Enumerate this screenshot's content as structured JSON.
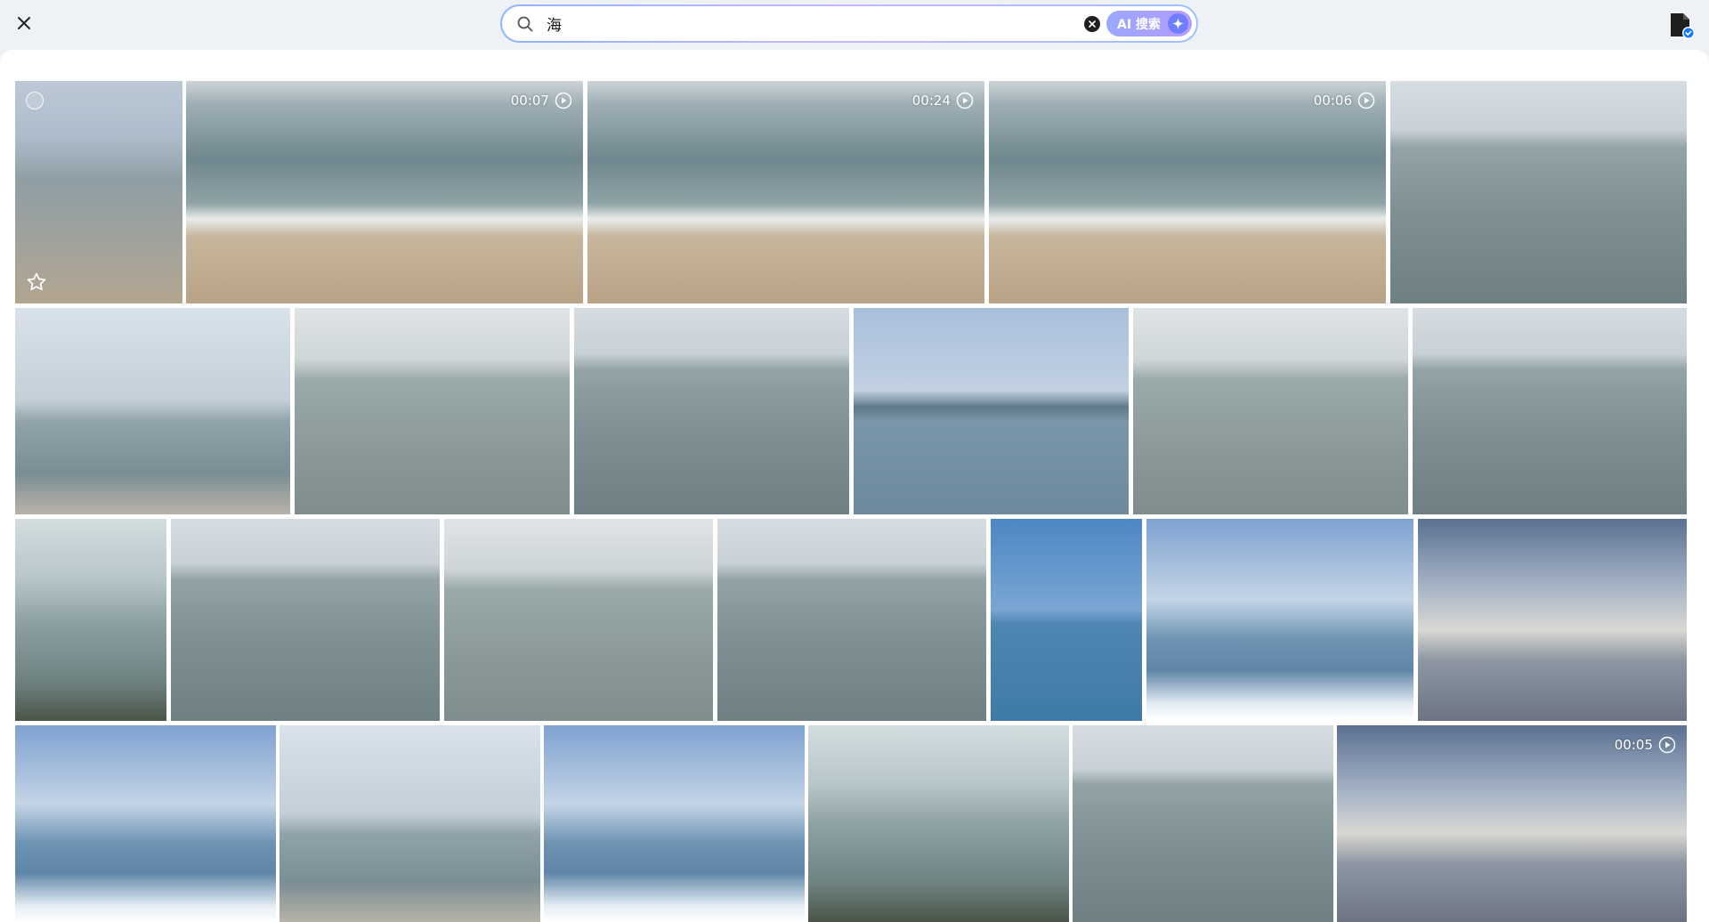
{
  "search": {
    "query": "海",
    "ai_label": "AI 搜索"
  },
  "photos": [
    {
      "type": "photo",
      "scene": "shore"
    },
    {
      "type": "video",
      "duration": "00:07",
      "scene": "beach"
    },
    {
      "type": "video",
      "duration": "00:24",
      "scene": "beach"
    },
    {
      "type": "video",
      "duration": "00:06",
      "scene": "beach"
    },
    {
      "type": "photo",
      "scene": "gray-sea"
    },
    {
      "type": "photo",
      "scene": "railing"
    },
    {
      "type": "photo",
      "scene": "rocks"
    },
    {
      "type": "photo",
      "scene": "gray-sea"
    },
    {
      "type": "photo",
      "scene": "island"
    },
    {
      "type": "photo",
      "scene": "rocks"
    },
    {
      "type": "photo",
      "scene": "gray-sea"
    },
    {
      "type": "photo",
      "scene": "coast"
    },
    {
      "type": "photo",
      "scene": "gray-sea"
    },
    {
      "type": "photo",
      "scene": "rocks"
    },
    {
      "type": "photo",
      "scene": "gray-sea"
    },
    {
      "type": "photo",
      "scene": "blue-sea"
    },
    {
      "type": "photo",
      "scene": "boat-wake"
    },
    {
      "type": "photo",
      "scene": "cloudy"
    },
    {
      "type": "photo",
      "scene": "boat-wake"
    },
    {
      "type": "photo",
      "scene": "railing"
    },
    {
      "type": "photo",
      "scene": "boat-wake"
    },
    {
      "type": "photo",
      "scene": "coast"
    },
    {
      "type": "photo",
      "scene": "gray-sea"
    },
    {
      "type": "video",
      "duration": "00:05",
      "scene": "cloudy"
    }
  ]
}
